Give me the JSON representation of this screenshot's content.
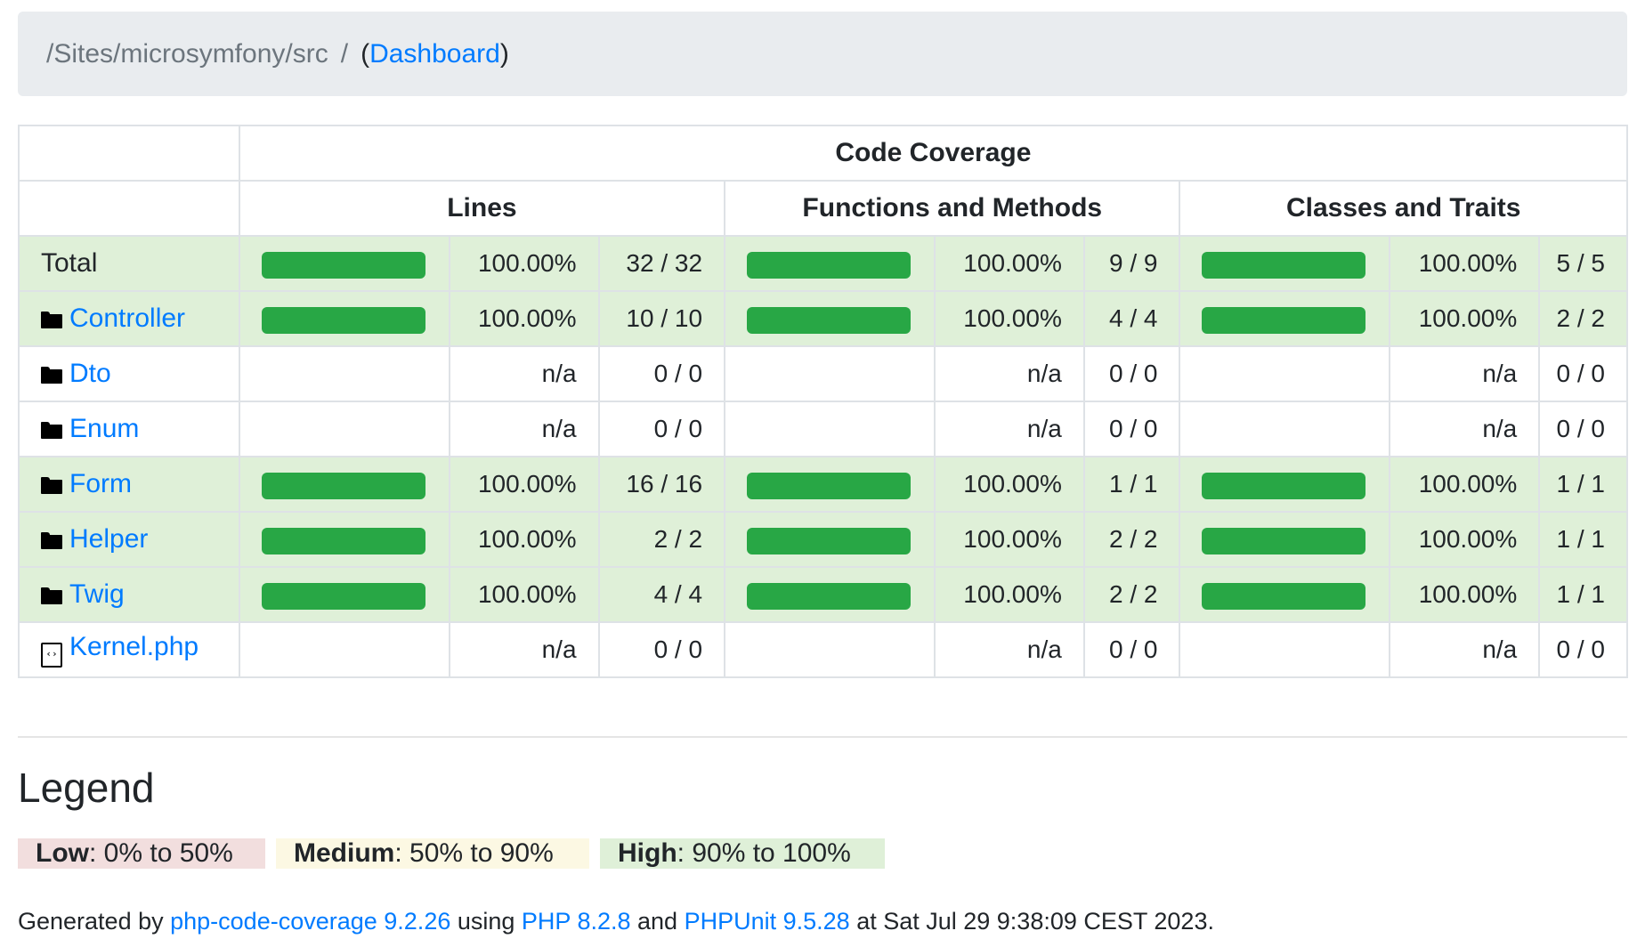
{
  "breadcrumb": {
    "path": "/Sites/microsymfony/src",
    "separator": "/",
    "open_paren": "(",
    "link": "Dashboard",
    "close_paren": ")"
  },
  "table": {
    "title": "Code Coverage",
    "groups": [
      "Lines",
      "Functions and Methods",
      "Classes and Traits"
    ],
    "rows": [
      {
        "name": "Total",
        "type": "total",
        "status": "high",
        "lines": {
          "progress": 100,
          "percent": "100.00%",
          "count": "32 / 32"
        },
        "functions": {
          "progress": 100,
          "percent": "100.00%",
          "count": "9 / 9"
        },
        "classes": {
          "progress": 100,
          "percent": "100.00%",
          "count": "5 / 5"
        }
      },
      {
        "name": "Controller",
        "type": "folder",
        "status": "high",
        "lines": {
          "progress": 100,
          "percent": "100.00%",
          "count": "10 / 10"
        },
        "functions": {
          "progress": 100,
          "percent": "100.00%",
          "count": "4 / 4"
        },
        "classes": {
          "progress": 100,
          "percent": "100.00%",
          "count": "2 / 2"
        }
      },
      {
        "name": "Dto",
        "type": "folder",
        "status": "na",
        "lines": {
          "progress": null,
          "percent": "n/a",
          "count": "0 / 0"
        },
        "functions": {
          "progress": null,
          "percent": "n/a",
          "count": "0 / 0"
        },
        "classes": {
          "progress": null,
          "percent": "n/a",
          "count": "0 / 0"
        }
      },
      {
        "name": "Enum",
        "type": "folder",
        "status": "na",
        "lines": {
          "progress": null,
          "percent": "n/a",
          "count": "0 / 0"
        },
        "functions": {
          "progress": null,
          "percent": "n/a",
          "count": "0 / 0"
        },
        "classes": {
          "progress": null,
          "percent": "n/a",
          "count": "0 / 0"
        }
      },
      {
        "name": "Form",
        "type": "folder",
        "status": "high",
        "lines": {
          "progress": 100,
          "percent": "100.00%",
          "count": "16 / 16"
        },
        "functions": {
          "progress": 100,
          "percent": "100.00%",
          "count": "1 / 1"
        },
        "classes": {
          "progress": 100,
          "percent": "100.00%",
          "count": "1 / 1"
        }
      },
      {
        "name": "Helper",
        "type": "folder",
        "status": "high",
        "lines": {
          "progress": 100,
          "percent": "100.00%",
          "count": "2 / 2"
        },
        "functions": {
          "progress": 100,
          "percent": "100.00%",
          "count": "2 / 2"
        },
        "classes": {
          "progress": 100,
          "percent": "100.00%",
          "count": "1 / 1"
        }
      },
      {
        "name": "Twig",
        "type": "folder",
        "status": "high",
        "lines": {
          "progress": 100,
          "percent": "100.00%",
          "count": "4 / 4"
        },
        "functions": {
          "progress": 100,
          "percent": "100.00%",
          "count": "2 / 2"
        },
        "classes": {
          "progress": 100,
          "percent": "100.00%",
          "count": "1 / 1"
        }
      },
      {
        "name": "Kernel.php",
        "type": "file",
        "status": "na",
        "lines": {
          "progress": null,
          "percent": "n/a",
          "count": "0 / 0"
        },
        "functions": {
          "progress": null,
          "percent": "n/a",
          "count": "0 / 0"
        },
        "classes": {
          "progress": null,
          "percent": "n/a",
          "count": "0 / 0"
        }
      }
    ]
  },
  "legend": {
    "title": "Legend",
    "low_label": "Low",
    "low_range": ": 0% to 50%",
    "medium_label": "Medium",
    "medium_range": ": 50% to 90%",
    "high_label": "High",
    "high_range": ": 90% to 100%"
  },
  "footer": {
    "text1": "Generated by ",
    "link1": "php-code-coverage 9.2.26",
    "text2": " using ",
    "link2": "PHP 8.2.8",
    "text3": " and ",
    "link3": "PHPUnit 9.5.28",
    "text4": " at Sat Jul 29 9:38:09 CEST 2023."
  },
  "colors": {
    "accent": "#007bff",
    "success_bg": "#dff0d8",
    "progress_bar": "#28a745",
    "low_bg": "#f2dede",
    "medium_bg": "#fcf8e3"
  }
}
